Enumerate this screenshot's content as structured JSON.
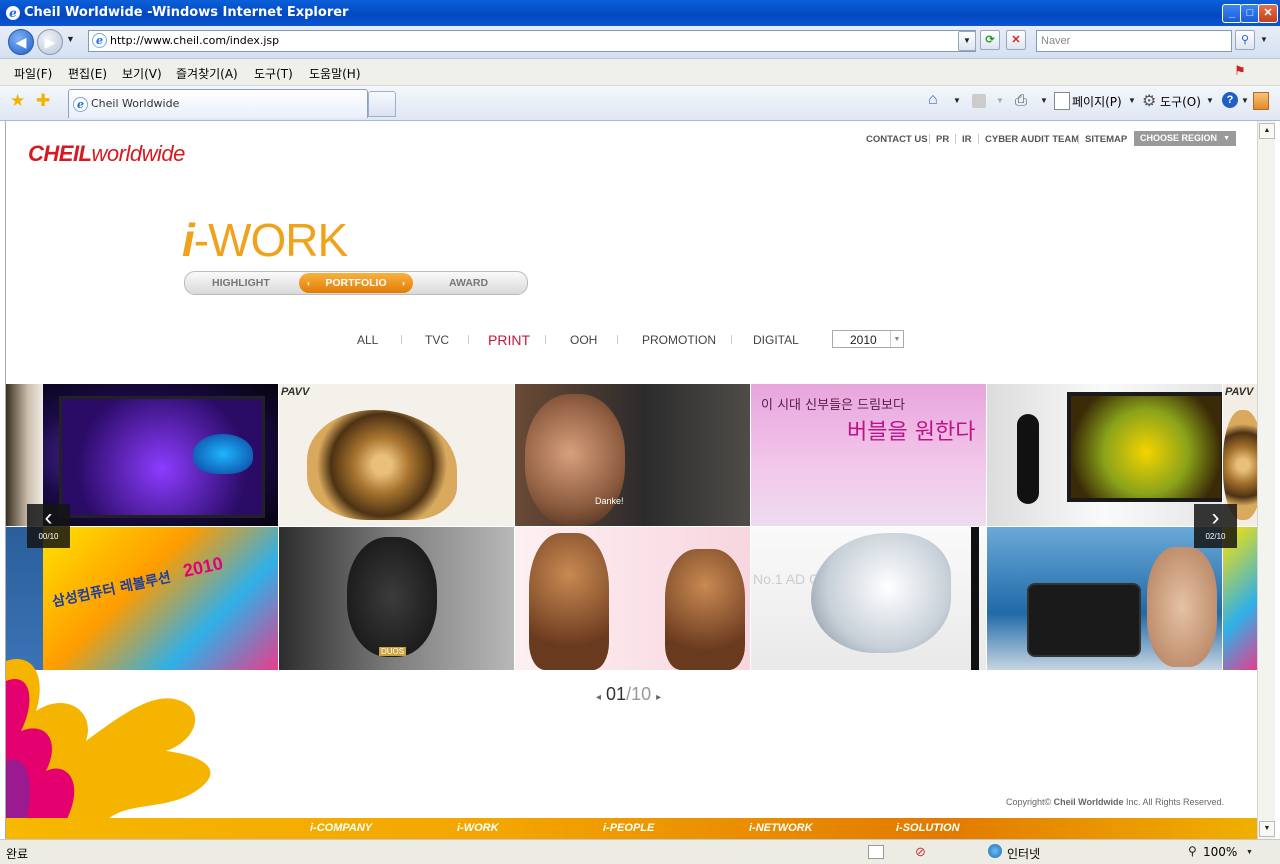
{
  "window": {
    "title": "Cheil Worldwide -Windows Internet Explorer"
  },
  "addressbar": {
    "url": "http://www.cheil.com/index.jsp",
    "search_placeholder": "Naver"
  },
  "menu": [
    "파일(F)",
    "편집(E)",
    "보기(V)",
    "즐겨찾기(A)",
    "도구(T)",
    "도움말(H)"
  ],
  "tab": {
    "title": "Cheil Worldwide"
  },
  "commandbar": {
    "page_label": "페이지(P)",
    "tools_label": "도구(O)"
  },
  "site": {
    "topnav": [
      "CONTACT US",
      "PR",
      "IR",
      "CYBER AUDIT TEAM",
      "SITEMAP"
    ],
    "region_button": "CHOOSE REGION",
    "logo_bold": "CHEIL",
    "logo_rest": "worldwide",
    "section_title_i": "i",
    "section_title_rest": "-WORK",
    "subnav": {
      "highlight": "HIGHLIGHT",
      "portfolio": "PORTFOLIO",
      "award": "AWARD"
    },
    "categories": [
      "ALL",
      "TVC",
      "PRINT",
      "OOH",
      "PROMOTION",
      "DIGITAL"
    ],
    "active_category": "PRINT",
    "year": "2010",
    "prev_counter": "00/10",
    "next_counter": "02/10",
    "page_current": "01",
    "page_total": "/10",
    "copyright_prefix": "Copyright© ",
    "copyright_company": "Cheil Worldwide",
    "copyright_suffix": " Inc. All Rights Reserved.",
    "footer_nav": [
      "i-COMPANY",
      "i-WORK",
      "i-PEOPLE",
      "i-NETWORK",
      "i-SOLUTION"
    ],
    "thumb_texts": {
      "pavv": "PAVV",
      "korean_headline_1": "이 시대 신부들은 드림보다",
      "korean_headline_2": "버블을 원한다",
      "promo_title": "삼성컴퓨터 레볼루션",
      "promo_year": "2010",
      "duos": "DUOS",
      "no1": "No.1 AD Channel",
      "danke": "Danke!"
    }
  },
  "status": {
    "left": "완료",
    "zone": "인터넷",
    "zoom": "100%"
  },
  "colors": {
    "brand_red": "#d71920",
    "accent_orange": "#f0a21c",
    "active_category": "#c7163c"
  }
}
